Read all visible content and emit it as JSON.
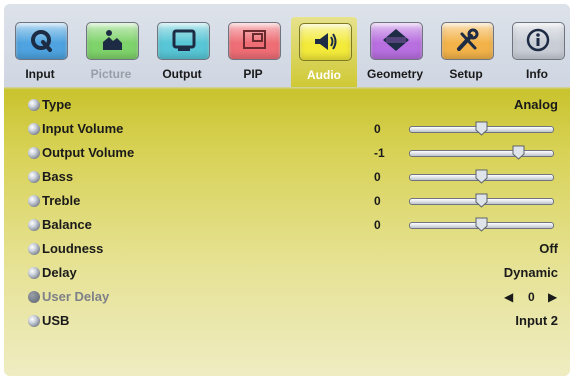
{
  "tabs": [
    {
      "label": "Input",
      "icon": "input-icon",
      "color": "#4ea3e0",
      "dim": false,
      "active": false
    },
    {
      "label": "Picture",
      "icon": "picture-icon",
      "color": "#7fd36b",
      "dim": true,
      "active": false
    },
    {
      "label": "Output",
      "icon": "output-icon",
      "color": "#58c6d6",
      "dim": false,
      "active": false
    },
    {
      "label": "PIP",
      "icon": "pip-icon",
      "color": "#ef6e76",
      "dim": false,
      "active": false
    },
    {
      "label": "Audio",
      "icon": "audio-icon",
      "color": "#f3ea3a",
      "dim": false,
      "active": true
    },
    {
      "label": "Geometry",
      "icon": "geometry-icon",
      "color": "#b86fe0",
      "dim": false,
      "active": false
    },
    {
      "label": "Setup",
      "icon": "setup-icon",
      "color": "#f3b34a",
      "dim": false,
      "active": false
    },
    {
      "label": "Info",
      "icon": "info-icon",
      "color": "#c9ced6",
      "dim": false,
      "active": false
    }
  ],
  "rows": [
    {
      "label": "Type",
      "value": "Analog"
    },
    {
      "label": "Input Volume",
      "number": "0",
      "level": 0.5
    },
    {
      "label": "Output Volume",
      "number": "-1",
      "level": 0.76
    },
    {
      "label": "Bass",
      "number": "0",
      "level": 0.5
    },
    {
      "label": "Treble",
      "number": "0",
      "level": 0.5
    },
    {
      "label": "Balance",
      "number": "0",
      "level": 0.5
    },
    {
      "label": "Loudness",
      "value": "Off"
    },
    {
      "label": "Delay",
      "value": "Dynamic"
    },
    {
      "label": "User Delay",
      "stepper": "0",
      "dim": true
    },
    {
      "label": "USB",
      "value": "Input 2"
    }
  ]
}
